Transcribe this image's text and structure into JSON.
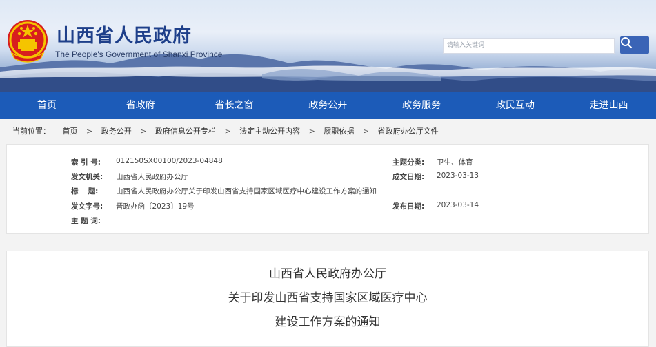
{
  "header": {
    "site_title": "山西省人民政府",
    "site_subtitle": "The People's Government of Shanxi Province",
    "search_placeholder": "请输入关键词",
    "search_icon": "search-icon",
    "emblem_icon": "national-emblem-icon"
  },
  "nav": {
    "items": [
      {
        "label": "首页"
      },
      {
        "label": "省政府"
      },
      {
        "label": "省长之窗"
      },
      {
        "label": "政务公开"
      },
      {
        "label": "政务服务"
      },
      {
        "label": "政民互动"
      },
      {
        "label": "走进山西"
      }
    ]
  },
  "breadcrumb": {
    "prefix": "当前位置：",
    "items": [
      "首页",
      "政务公开",
      "政府信息公开专栏",
      "法定主动公开内容",
      "履职依据",
      "省政府办公厅文件"
    ],
    "separator": ">"
  },
  "meta": {
    "index_label": "索 引 号:",
    "index_value": "012150SX00100/2023-04848",
    "issuer_label": "发文机关:",
    "issuer_value": "山西省人民政府办公厅",
    "title_label": "标　 题:",
    "title_value": "山西省人民政府办公厅关于印发山西省支持国家区域医疗中心建设工作方案的通知",
    "docno_label": "发文字号:",
    "docno_value": "晋政办函〔2023〕19号",
    "keywords_label": "主 题 词:",
    "keywords_value": "",
    "category_label": "主题分类:",
    "category_value": "卫生、体育",
    "created_label": "成文日期:",
    "created_value": "2023-03-13",
    "published_label": "发布日期:",
    "published_value": "2023-03-14"
  },
  "document": {
    "line1": "山西省人民政府办公厅",
    "line2": "关于印发山西省支持国家区域医疗中心",
    "line3": "建设工作方案的通知"
  },
  "colors": {
    "nav_bg": "#1c5bb8",
    "title_blue": "#1e3f8a",
    "search_button": "#3a64b6"
  }
}
